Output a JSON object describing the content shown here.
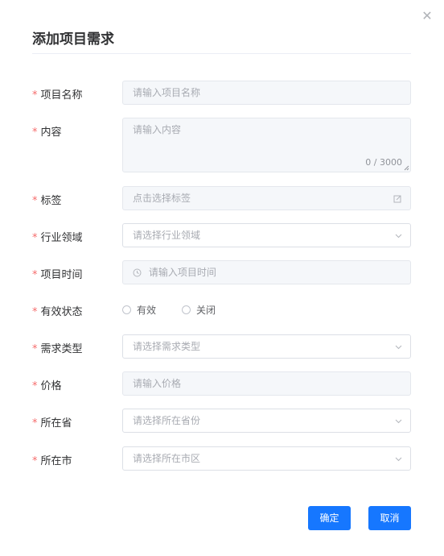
{
  "dialog": {
    "title": "添加项目需求",
    "close_icon": "close-icon"
  },
  "form": {
    "required_mark": "*",
    "name": {
      "label": "项目名称",
      "placeholder": "请输入项目名称"
    },
    "content": {
      "label": "内容",
      "placeholder": "请输入内容",
      "counter": "0 / 3000"
    },
    "tags": {
      "label": "标签",
      "placeholder": "点击选择标签",
      "icon": "edit-icon"
    },
    "industry": {
      "label": "行业领域",
      "placeholder": "请选择行业领域",
      "icon": "chevron-down-icon"
    },
    "time": {
      "label": "项目时间",
      "placeholder": "请输入项目时间",
      "icon": "clock-icon"
    },
    "status": {
      "label": "有效状态",
      "options": [
        "有效",
        "关闭"
      ]
    },
    "demand_type": {
      "label": "需求类型",
      "placeholder": "请选择需求类型"
    },
    "price": {
      "label": "价格",
      "placeholder": "请输入价格"
    },
    "province": {
      "label": "所在省",
      "placeholder": "请选择所在省份"
    },
    "city": {
      "label": "所在市",
      "placeholder": "请选择所在市区"
    }
  },
  "footer": {
    "confirm_label": "确定",
    "cancel_label": "取消"
  },
  "colors": {
    "primary": "#1677ff",
    "required": "#f56c6c"
  }
}
